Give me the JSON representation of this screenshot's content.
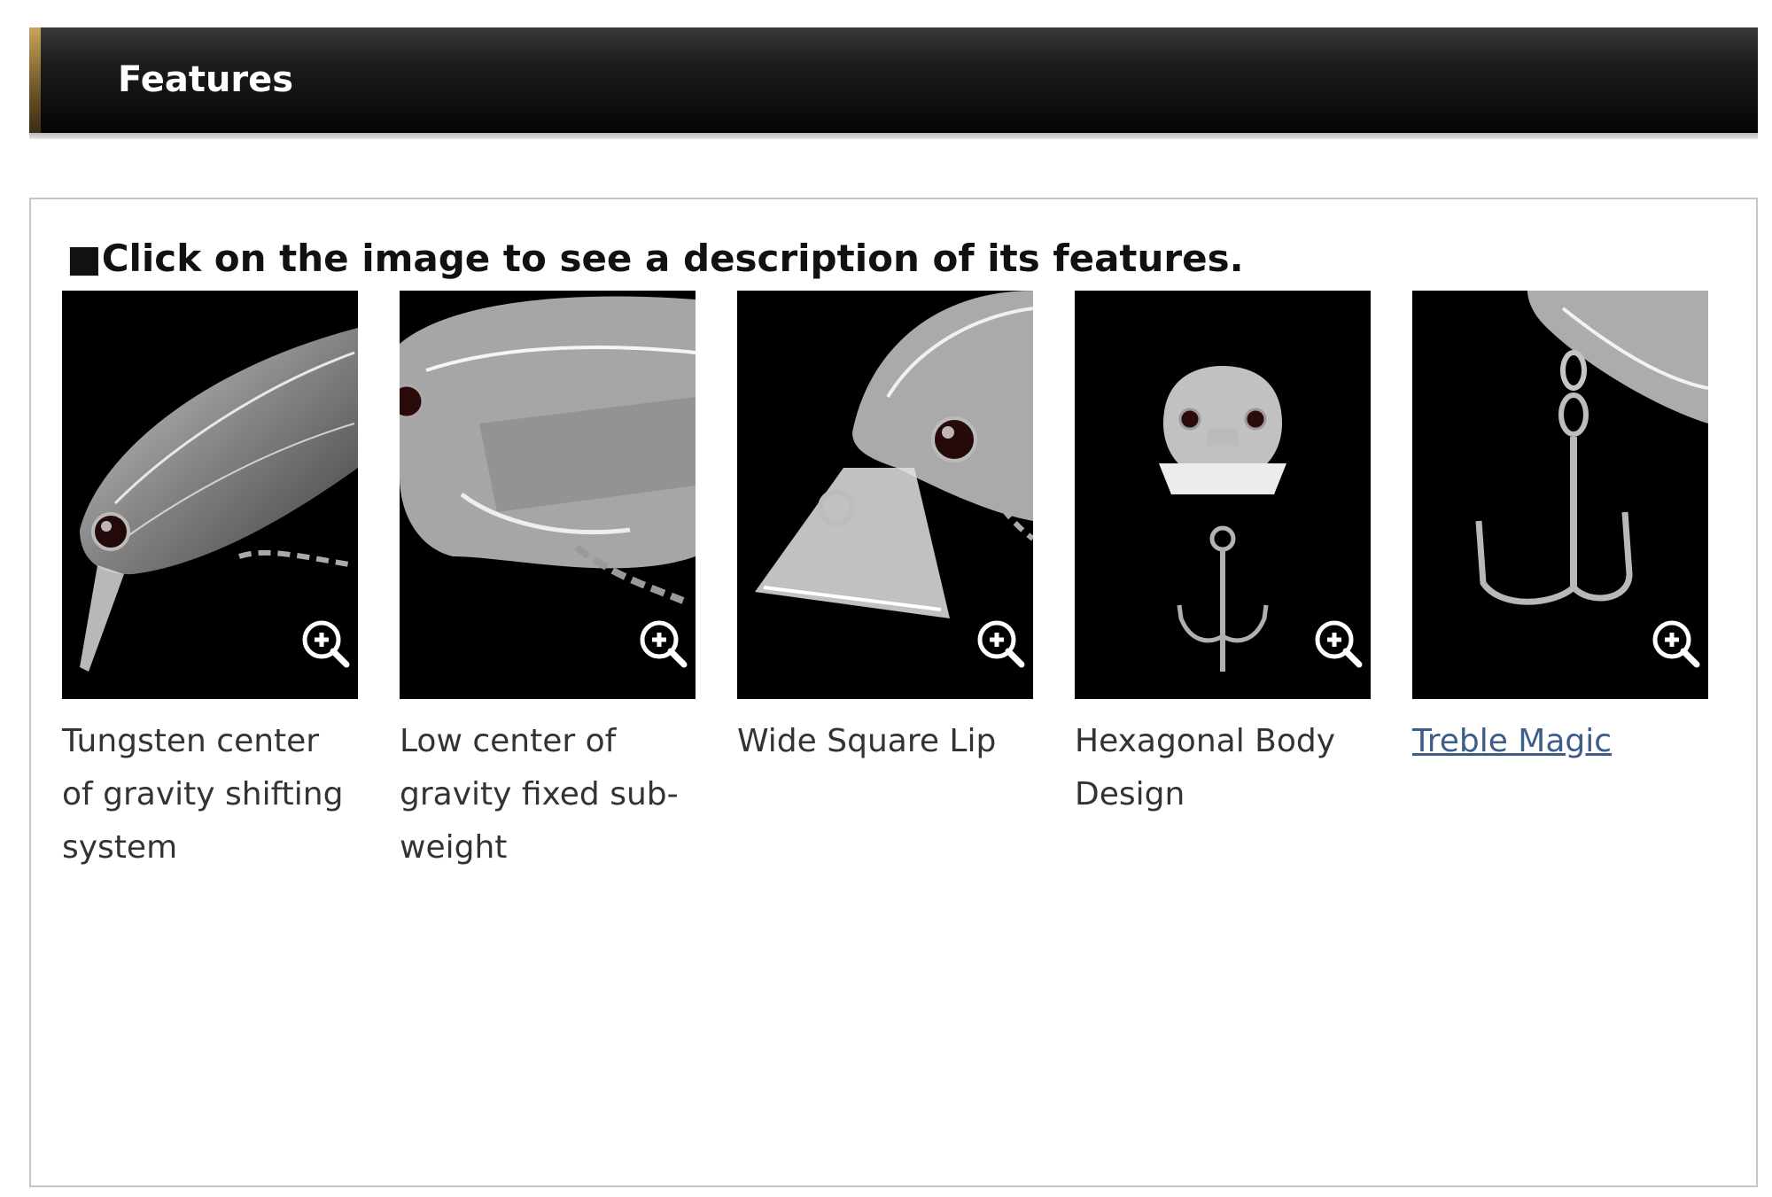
{
  "header": {
    "title": "Features"
  },
  "panel": {
    "instruction_prefix": "■",
    "instruction": "Click on the image to see a description of its features."
  },
  "features": [
    {
      "caption": "Tungsten center of gravity shifting system",
      "icon": "zoom-in-icon"
    },
    {
      "caption": "Low center of gravity fixed sub-weight",
      "icon": "zoom-in-icon"
    },
    {
      "caption": "Wide Square Lip",
      "icon": "zoom-in-icon"
    },
    {
      "caption": "Hexagonal Body Design",
      "icon": "zoom-in-icon"
    },
    {
      "caption": "Treble Magic",
      "icon": "zoom-in-icon",
      "is_link": true
    }
  ],
  "colors": {
    "header_bg": "#050505",
    "accent": "#c8a45a",
    "link": "#3d5d88",
    "thumb_bg": "#000000"
  }
}
